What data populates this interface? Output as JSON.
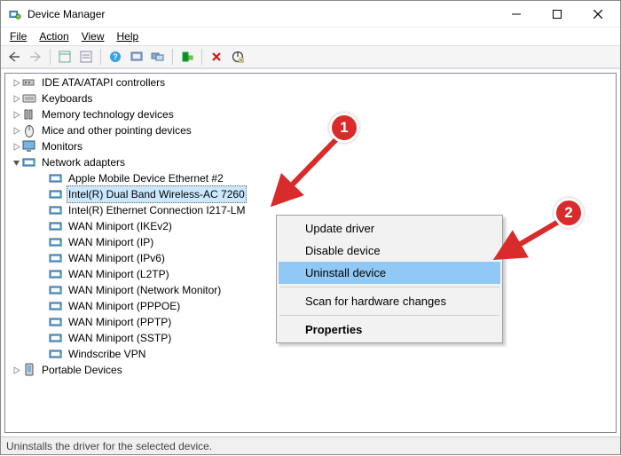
{
  "window": {
    "title": "Device Manager"
  },
  "menu": {
    "file": "File",
    "action": "Action",
    "view": "View",
    "help": "Help"
  },
  "toolbar_icons": [
    "back-icon",
    "forward-icon",
    "sep",
    "show-hidden-icon",
    "properties-icon",
    "sep",
    "help-icon",
    "console-icon",
    "computers-icon",
    "sep",
    "scan-hardware-icon",
    "sep",
    "uninstall-icon",
    "disable-icon"
  ],
  "tree": [
    {
      "label": "IDE ATA/ATAPI controllers",
      "icon": "controller",
      "expanded": false,
      "depth": 0
    },
    {
      "label": "Keyboards",
      "icon": "keyboard",
      "expanded": false,
      "depth": 0
    },
    {
      "label": "Memory technology devices",
      "icon": "memory",
      "expanded": false,
      "depth": 0
    },
    {
      "label": "Mice and other pointing devices",
      "icon": "mouse",
      "expanded": false,
      "depth": 0
    },
    {
      "label": "Monitors",
      "icon": "monitor",
      "expanded": false,
      "depth": 0
    },
    {
      "label": "Network adapters",
      "icon": "network",
      "expanded": true,
      "depth": 0
    },
    {
      "label": "Apple Mobile Device Ethernet #2",
      "icon": "nic",
      "depth": 1
    },
    {
      "label": "Intel(R) Dual Band Wireless-AC 7260",
      "icon": "nic",
      "depth": 1,
      "selected": true
    },
    {
      "label": "Intel(R) Ethernet Connection I217-LM",
      "icon": "nic",
      "depth": 1
    },
    {
      "label": "WAN Miniport (IKEv2)",
      "icon": "nic",
      "depth": 1
    },
    {
      "label": "WAN Miniport (IP)",
      "icon": "nic",
      "depth": 1
    },
    {
      "label": "WAN Miniport (IPv6)",
      "icon": "nic",
      "depth": 1
    },
    {
      "label": "WAN Miniport (L2TP)",
      "icon": "nic",
      "depth": 1
    },
    {
      "label": "WAN Miniport (Network Monitor)",
      "icon": "nic",
      "depth": 1
    },
    {
      "label": "WAN Miniport (PPPOE)",
      "icon": "nic",
      "depth": 1
    },
    {
      "label": "WAN Miniport (PPTP)",
      "icon": "nic",
      "depth": 1
    },
    {
      "label": "WAN Miniport (SSTP)",
      "icon": "nic",
      "depth": 1
    },
    {
      "label": "Windscribe VPN",
      "icon": "nic",
      "depth": 1
    },
    {
      "label": "Portable Devices",
      "icon": "portable",
      "expanded": false,
      "depth": 0
    }
  ],
  "context_menu": {
    "update": "Update driver",
    "disable": "Disable device",
    "uninstall": "Uninstall device",
    "scan": "Scan for hardware changes",
    "properties": "Properties"
  },
  "status": "Uninstalls the driver for the selected device.",
  "annotations": {
    "m1": "1",
    "m2": "2"
  }
}
